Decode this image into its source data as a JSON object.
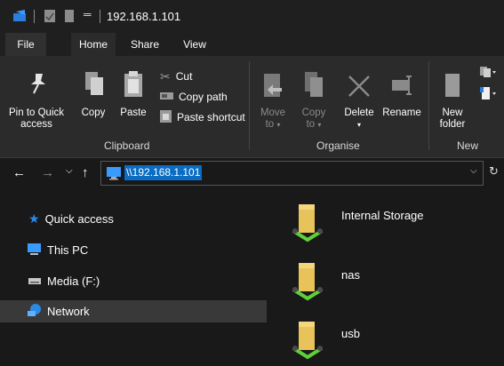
{
  "window": {
    "title": "192.168.1.101"
  },
  "tabs": [
    {
      "label": "File"
    },
    {
      "label": "Home"
    },
    {
      "label": "Share"
    },
    {
      "label": "View"
    }
  ],
  "ribbon": {
    "clipboard": {
      "label": "Clipboard",
      "pin": [
        "Pin to Quick",
        "access"
      ],
      "copy": "Copy",
      "paste": "Paste",
      "cut": "Cut",
      "copy_path": "Copy path",
      "paste_shortcut": "Paste shortcut"
    },
    "organise": {
      "label": "Organise",
      "move": [
        "Move",
        "to"
      ],
      "copy": [
        "Copy",
        "to"
      ],
      "delete": "Delete",
      "rename": "Rename"
    },
    "new": {
      "label": "New",
      "folder": [
        "New",
        "folder"
      ]
    }
  },
  "address": {
    "path": "\\\\192.168.1.101"
  },
  "nav": [
    {
      "label": "Quick access",
      "icon": "star-icon"
    },
    {
      "label": "This PC",
      "icon": "pc-icon"
    },
    {
      "label": "Media (F:)",
      "icon": "drive-icon"
    },
    {
      "label": "Network",
      "icon": "network-icon",
      "selected": true
    }
  ],
  "items": [
    {
      "name": "Internal Storage"
    },
    {
      "name": "nas"
    },
    {
      "name": "usb"
    }
  ],
  "colors": {
    "accent": "#0a6cc2",
    "background": "#191919",
    "ribbon": "#2b2b2b"
  }
}
